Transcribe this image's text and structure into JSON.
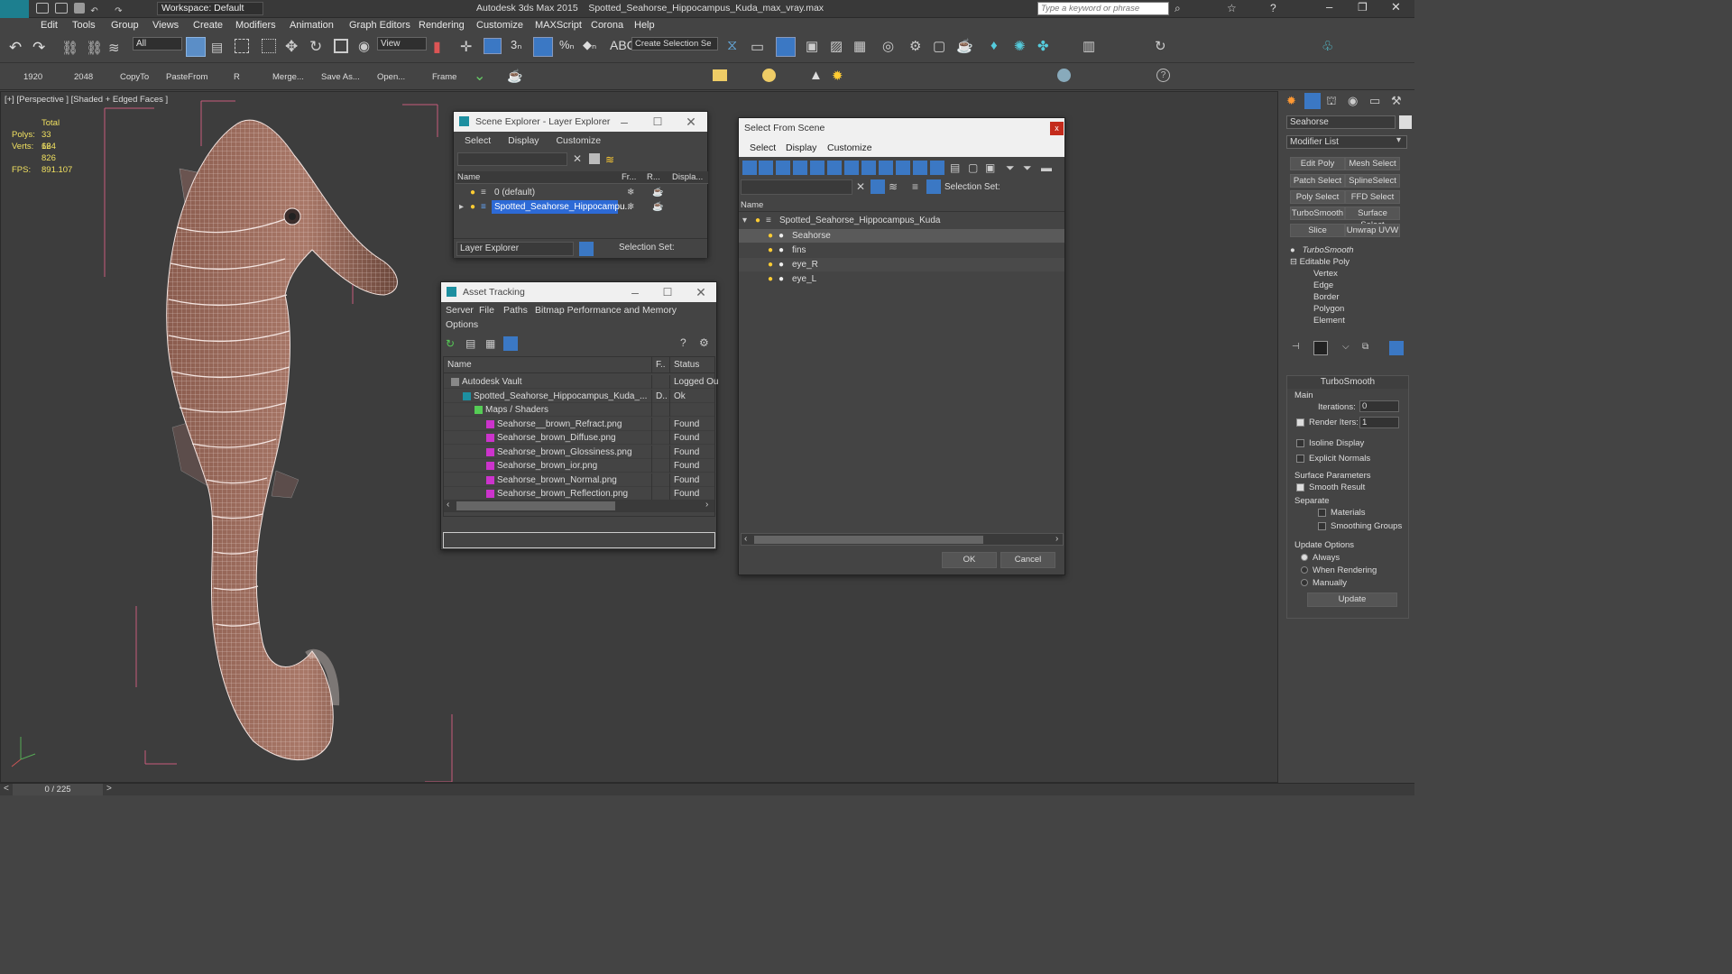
{
  "app": {
    "title": "Autodesk 3ds Max  2015",
    "file": "Spotted_Seahorse_Hippocampus_Kuda_max_vray.max",
    "workspace": "Workspace: Default",
    "search_placeholder": "Type a keyword or phrase",
    "logo": "MAX"
  },
  "menu": [
    "Edit",
    "Tools",
    "Group",
    "Views",
    "Create",
    "Modifiers",
    "Animation",
    "Graph Editors",
    "Rendering",
    "Customize",
    "MAXScript",
    "Corona",
    "Help"
  ],
  "toolbar": {
    "filter": "All",
    "view": "View",
    "selset": "Create Selection Se"
  },
  "toolbar2": [
    "1920",
    "2048",
    "CopyTo",
    "PasteFrom",
    "R",
    "Merge...",
    "Save As...",
    "Open...",
    "Frame"
  ],
  "viewport": {
    "label_a": "[+]",
    "label_b": "[Perspective ]",
    "label_c": "[Shaded + Edged Faces ]",
    "total_label": "Total",
    "polys_label": "Polys:",
    "polys": "33 624",
    "verts_label": "Verts:",
    "verts": "16 826",
    "fps_label": "FPS:",
    "fps": "891.107"
  },
  "scene_explorer": {
    "title": "Scene Explorer - Layer Explorer",
    "menu": [
      "Select",
      "Display",
      "Customize"
    ],
    "cols": [
      "Name",
      "Fr...",
      "R...",
      "Displa..."
    ],
    "rows": [
      "0 (default)",
      "Spotted_Seahorse_Hippocampu..."
    ],
    "footer_select": "Layer Explorer",
    "footer_selset": "Selection Set:"
  },
  "asset_tracking": {
    "title": "Asset Tracking",
    "menu": [
      "Server",
      "File",
      "Paths",
      "Bitmap Performance and Memory",
      "Options"
    ],
    "cols": [
      "Name",
      "F..",
      "Status"
    ],
    "rows": [
      {
        "name": "Autodesk Vault",
        "f": "",
        "status": "Logged Ou"
      },
      {
        "name": "Spotted_Seahorse_Hippocampus_Kuda_...",
        "f": "D..",
        "status": "Ok"
      },
      {
        "name": "Maps / Shaders",
        "f": "",
        "status": ""
      },
      {
        "name": "Seahorse__brown_Refract.png",
        "f": "",
        "status": "Found"
      },
      {
        "name": "Seahorse_brown_Diffuse.png",
        "f": "",
        "status": "Found"
      },
      {
        "name": "Seahorse_brown_Glossiness.png",
        "f": "",
        "status": "Found"
      },
      {
        "name": "Seahorse_brown_ior.png",
        "f": "",
        "status": "Found"
      },
      {
        "name": "Seahorse_brown_Normal.png",
        "f": "",
        "status": "Found"
      },
      {
        "name": "Seahorse_brown_Reflection.png",
        "f": "",
        "status": "Found"
      }
    ]
  },
  "select_from_scene": {
    "title": "Select From Scene",
    "close": "x",
    "menu": [
      "Select",
      "Display",
      "Customize"
    ],
    "selset": "Selection Set:",
    "col": "Name",
    "root": "Spotted_Seahorse_Hippocampus_Kuda",
    "items": [
      "Seahorse",
      "fins",
      "eye_R",
      "eye_L"
    ],
    "ok": "OK",
    "cancel": "Cancel"
  },
  "command_panel": {
    "object_name": "Seahorse",
    "modifier_list": "Modifier List",
    "buttons": [
      "Edit Poly",
      "Mesh Select",
      "Patch Select",
      "SplineSelect",
      "Poly Select",
      "FFD Select",
      "TurboSmooth",
      "Surface Select",
      "Slice",
      "Unwrap UVW"
    ],
    "stack": [
      "TurboSmooth",
      "Editable Poly",
      "Vertex",
      "Edge",
      "Border",
      "Polygon",
      "Element"
    ],
    "rollout": "TurboSmooth",
    "main": "Main",
    "iterations_label": "Iterations:",
    "iterations": "0",
    "render_iters_label": "Render Iters:",
    "render_iters": "1",
    "isoline": "Isoline Display",
    "explicit": "Explicit Normals",
    "surface_params": "Surface Parameters",
    "smooth_result": "Smooth Result",
    "separate": "Separate",
    "materials": "Materials",
    "smoothing_groups": "Smoothing Groups",
    "update_options": "Update Options",
    "always": "Always",
    "when_rendering": "When Rendering",
    "manually": "Manually",
    "update": "Update"
  },
  "status": {
    "frame": "0 / 225"
  }
}
